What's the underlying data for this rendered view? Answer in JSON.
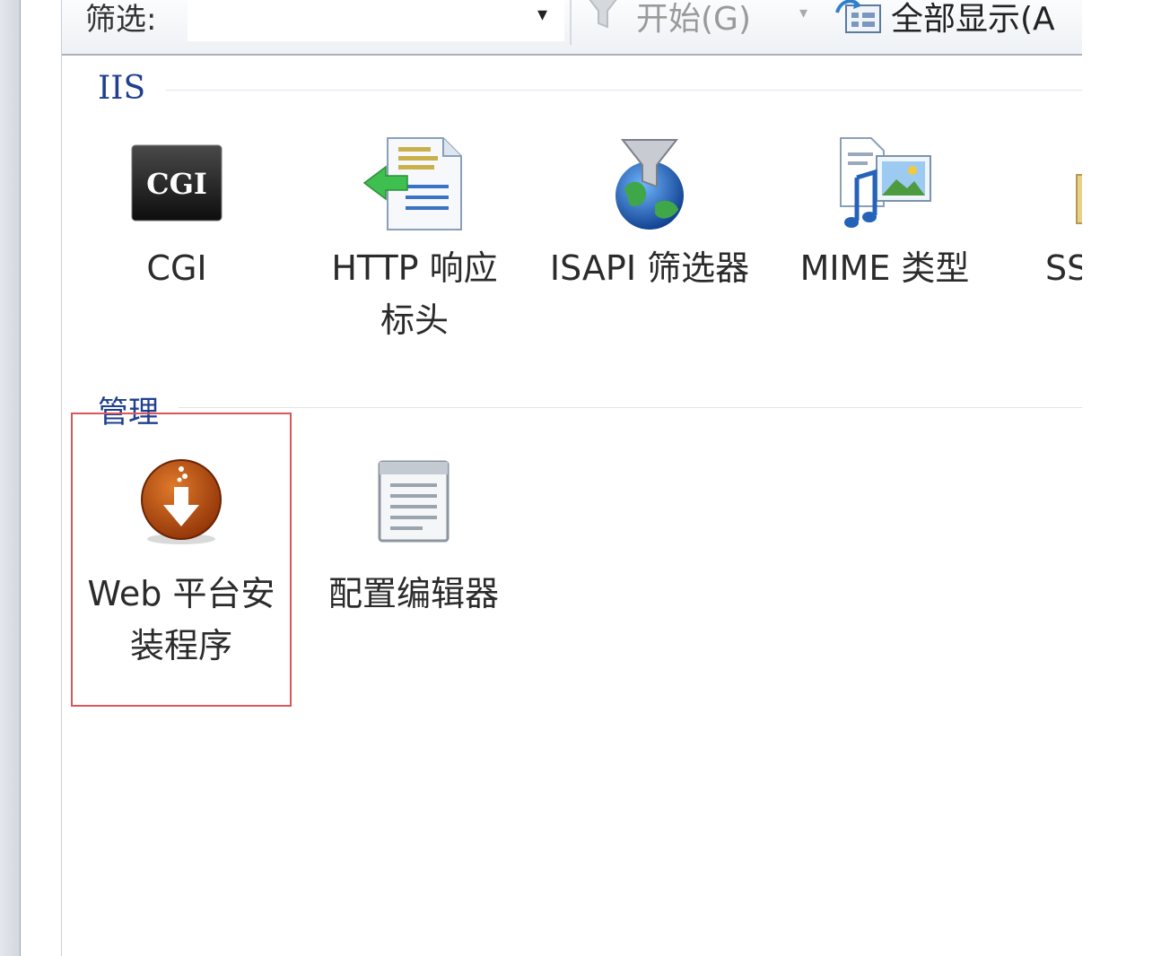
{
  "toolbar": {
    "filter_label": "筛选:",
    "dropdown_arrow": "▾",
    "go_label": "开始(G)",
    "go_arrow": "▾",
    "showall_label": "全部显示(A"
  },
  "groups": [
    {
      "title": "IIS",
      "items": [
        {
          "label": "CGI",
          "icon": "cgi-icon",
          "icon_text": "CGI"
        },
        {
          "label": "HTTP 响应标头",
          "icon": "http-response-headers-icon"
        },
        {
          "label": "ISAPI 筛选器",
          "icon": "isapi-filters-icon"
        },
        {
          "label": "MIME 类型",
          "icon": "mime-types-icon"
        },
        {
          "label": "SS",
          "icon": "ssl-icon"
        }
      ]
    },
    {
      "title": "管理",
      "items": [
        {
          "label": "Web 平台安装程序",
          "icon": "web-platform-installer-icon"
        },
        {
          "label": "配置编辑器",
          "icon": "configuration-editor-icon"
        }
      ]
    }
  ],
  "colors": {
    "group_title": "#1f3f8f",
    "highlight_border": "#d9565a"
  }
}
